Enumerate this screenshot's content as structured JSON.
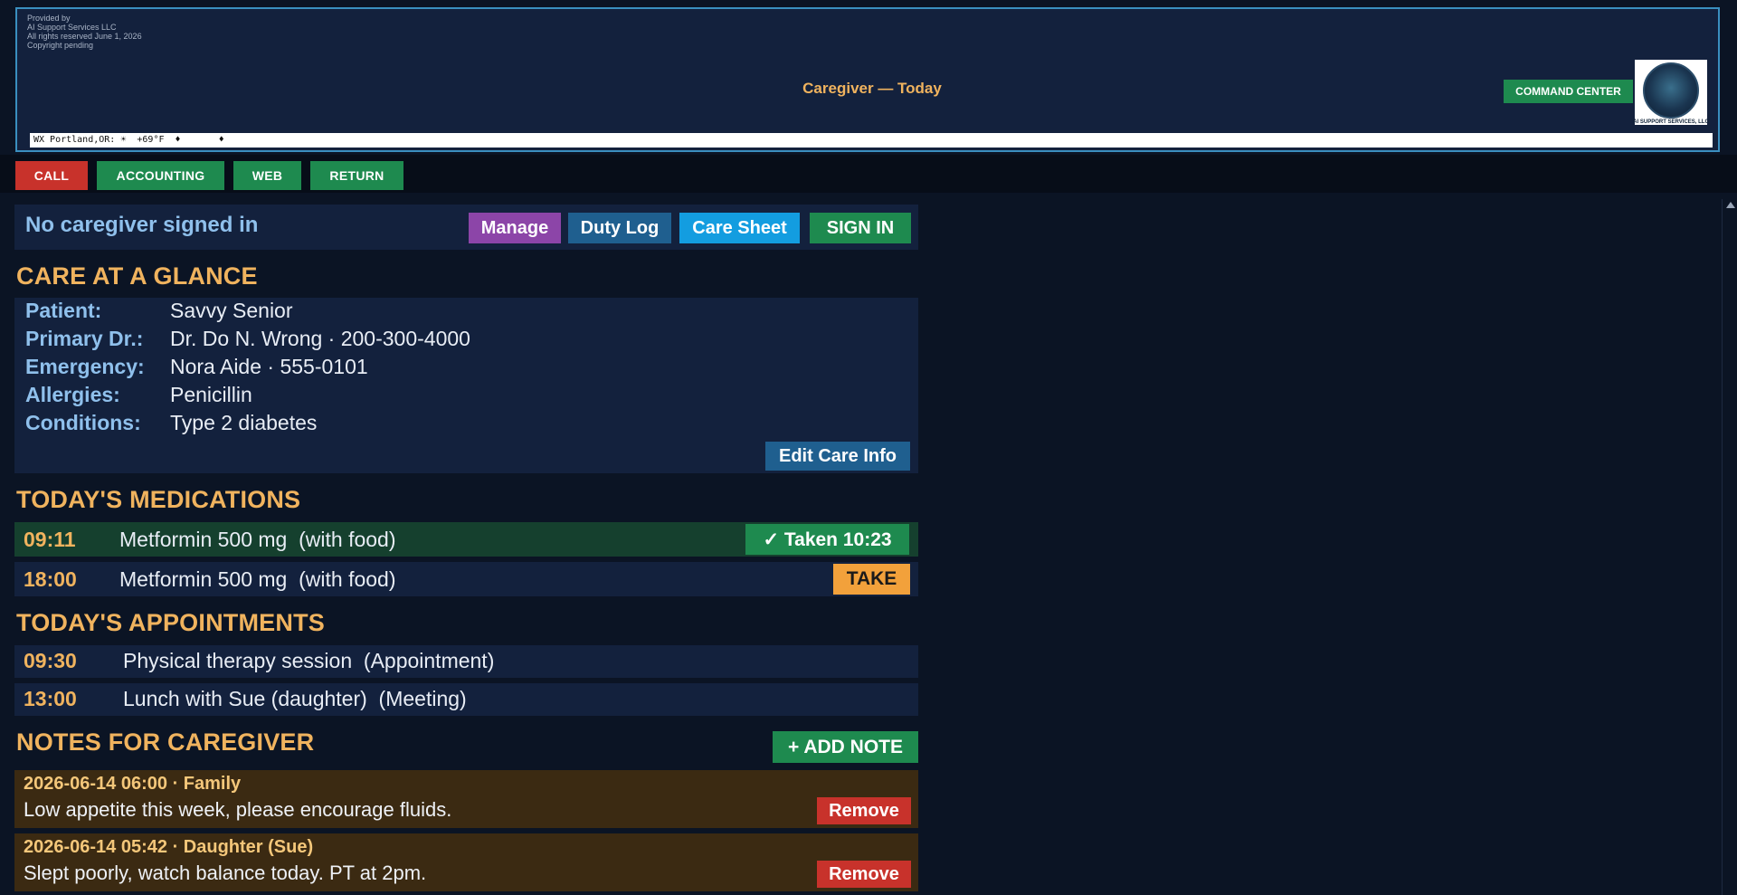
{
  "header": {
    "provided_lines": [
      "Provided by",
      "AI Support Services LLC",
      "All rights reserved  June 1, 2026",
      "Copyright pending"
    ],
    "title": "Caregiver — Today",
    "command_center_label": "COMMAND CENTER",
    "logo_caption": "AI SUPPORT SERVICES, LLC",
    "ticker_text": "WX Portland,OR: ☀  +69°F  ♦       ♦"
  },
  "nav": {
    "call": "CALL",
    "accounting": "ACCOUNTING",
    "web": "WEB",
    "return": "RETURN"
  },
  "signin": {
    "status": "No caregiver signed in",
    "manage": "Manage",
    "duty_log": "Duty Log",
    "care_sheet": "Care Sheet",
    "sign_in": "SIGN IN"
  },
  "glance": {
    "title": "CARE AT A GLANCE",
    "rows": [
      {
        "label": "Patient:",
        "value": "Savvy Senior"
      },
      {
        "label": "Primary Dr.:",
        "value": "Dr. Do N. Wrong · 200-300-4000"
      },
      {
        "label": "Emergency:",
        "value": "Nora Aide · 555-0101"
      },
      {
        "label": "Allergies:",
        "value": "Penicillin"
      },
      {
        "label": "Conditions:",
        "value": "Type 2 diabetes"
      }
    ],
    "edit_label": "Edit Care Info"
  },
  "medications": {
    "title": "TODAY'S MEDICATIONS",
    "items": [
      {
        "time": "09:11",
        "name": "Metformin 500 mg  (with food)",
        "action": "✓ Taken 10:23"
      },
      {
        "time": "18:00",
        "name": "Metformin 500 mg  (with food)",
        "action": "TAKE"
      }
    ]
  },
  "appointments": {
    "title": "TODAY'S APPOINTMENTS",
    "items": [
      {
        "time": "09:30",
        "name": "Physical therapy session  (Appointment)"
      },
      {
        "time": "13:00",
        "name": "Lunch with Sue (daughter)  (Meeting)"
      }
    ]
  },
  "notes": {
    "title": "NOTES FOR CAREGIVER",
    "add_label": "+ ADD NOTE",
    "items": [
      {
        "head": "2026-06-14 06:00 · Family",
        "text": "Low appetite this week, please encourage fluids.",
        "remove": "Remove"
      },
      {
        "head": "2026-06-14 05:42 · Daughter (Sue)",
        "text": "Slept poorly, watch balance today. PT at 2pm.",
        "remove": "Remove"
      }
    ]
  },
  "colors": {
    "accent_gold": "#f0b35e",
    "label_blue": "#8fc0ec",
    "green": "#1e8a4f",
    "red": "#c8322b",
    "purple": "#8c45a8",
    "cyan": "#139de0",
    "orange": "#f2a13b"
  }
}
